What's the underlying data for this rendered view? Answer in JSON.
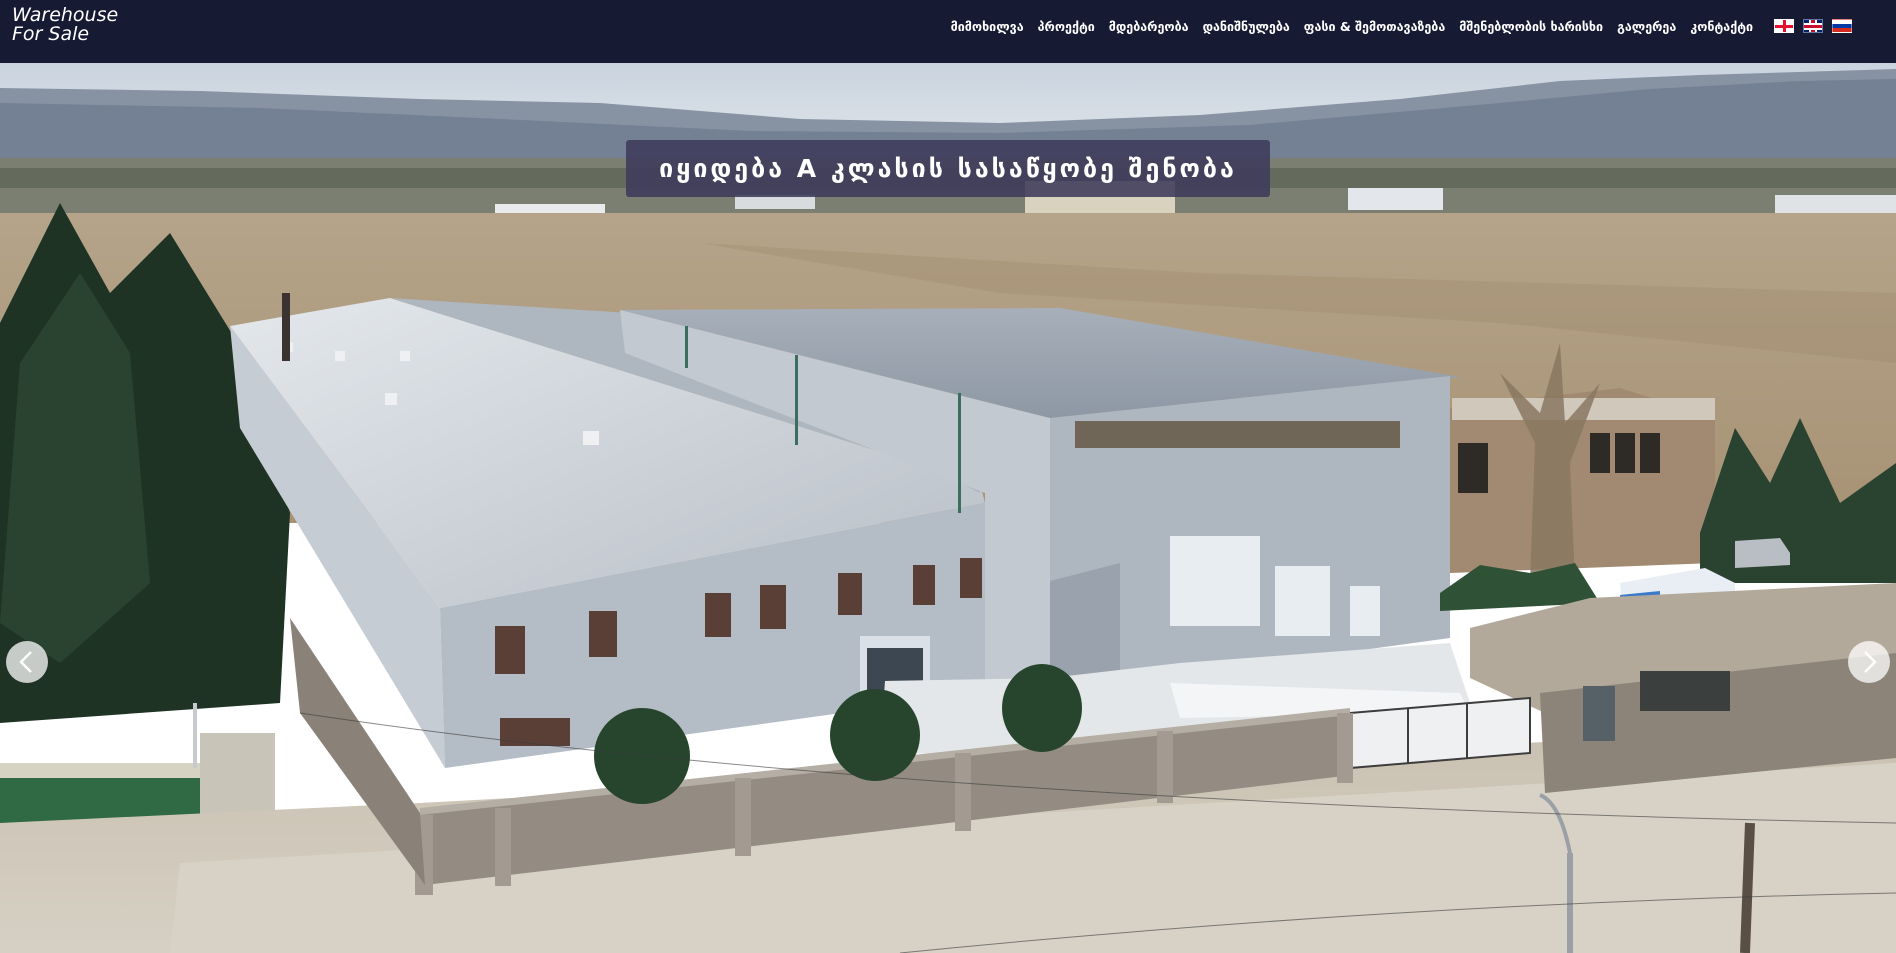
{
  "site": {
    "logo_line1": "Warehouse",
    "logo_line2": "For Sale"
  },
  "nav": {
    "items": [
      {
        "label": "მიმოხილვა"
      },
      {
        "label": "პროექტი"
      },
      {
        "label": "მდებარეობა"
      },
      {
        "label": "დანიშნულება"
      },
      {
        "label": "ფასი & შემოთავაზება"
      },
      {
        "label": "მშენებლობის ხარისხი"
      },
      {
        "label": "გალერეა"
      },
      {
        "label": "კონტაქტი"
      }
    ],
    "languages": [
      {
        "icon": "georgia-flag-icon"
      },
      {
        "icon": "uk-flag-icon"
      },
      {
        "icon": "russia-flag-icon"
      }
    ]
  },
  "hero": {
    "title": "იყიდება A კლასის სასაწყობე შენობა",
    "prev_icon": "chevron-left-icon",
    "next_icon": "chevron-right-icon"
  },
  "colors": {
    "header_bg": "#161a33",
    "title_box_bg": "#3e3a5a"
  }
}
